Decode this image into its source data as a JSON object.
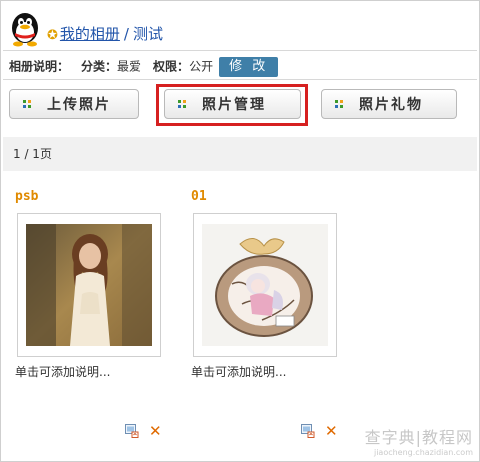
{
  "header": {
    "album_link": "我的相册",
    "separator": "/",
    "current_album": "测试",
    "star_icon": "star-icon",
    "avatar_icon": "qq-penguin-avatar"
  },
  "meta": {
    "desc_label": "相册说明：",
    "category_label": "分类：",
    "category_value": "最爱",
    "permission_label": "权限：",
    "permission_value": "公开",
    "edit_label": "修 改"
  },
  "toolbar": {
    "upload_label": "上传照片",
    "manage_label": "照片管理",
    "gift_label": "照片礼物"
  },
  "pager": {
    "text": "1 / 1页"
  },
  "photos": [
    {
      "title": "psb",
      "description": "单击可添加说明..."
    },
    {
      "title": "01",
      "description": "单击可添加说明..."
    }
  ],
  "watermark": {
    "line1": "查字典|教程网",
    "line2": "jiaocheng.chazidian.com"
  },
  "colors": {
    "accent": "#2255aa",
    "highlight": "#d62020",
    "title": "#e08a00"
  }
}
